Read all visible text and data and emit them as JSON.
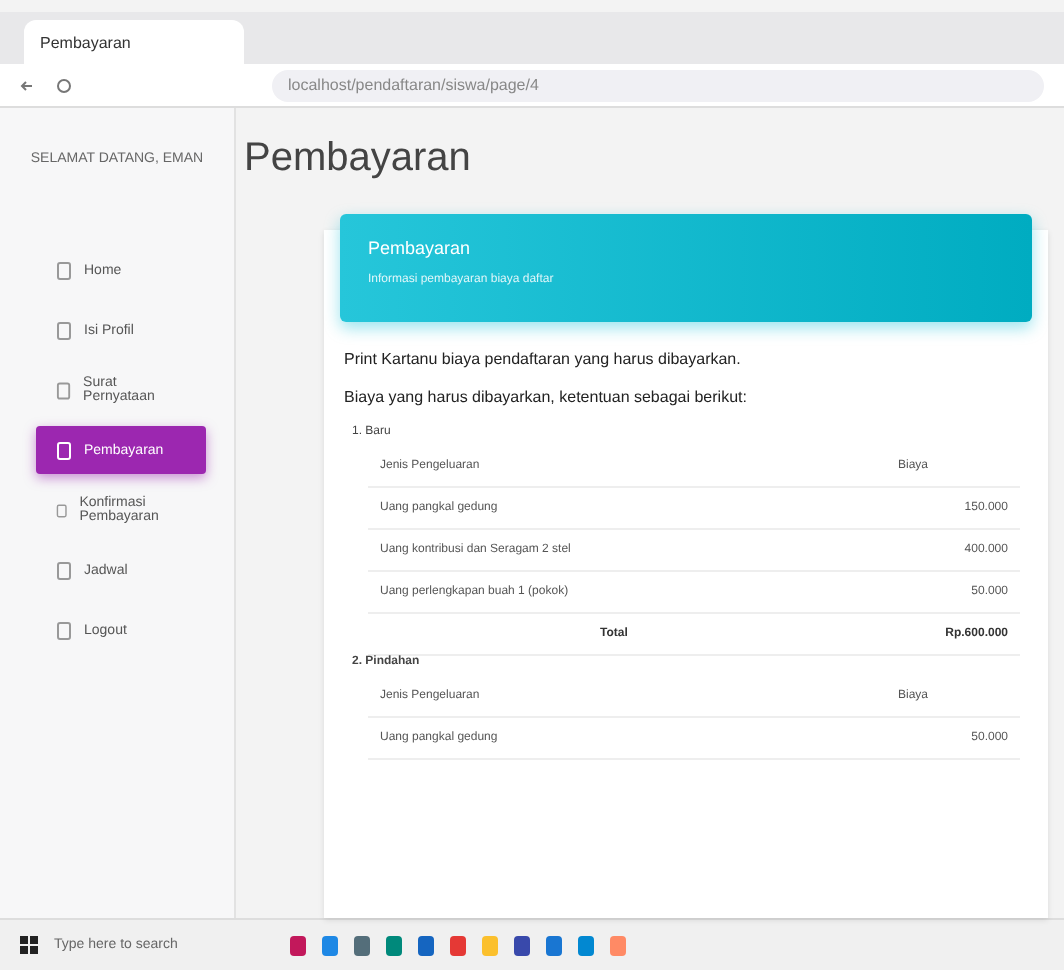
{
  "browser": {
    "tab_title": "Pembayaran",
    "address": "localhost/pendaftaran/siswa/page/4"
  },
  "sidebar": {
    "greeting": "SELAMAT DATANG, EMAN",
    "items": [
      {
        "label": "Home",
        "selected": false
      },
      {
        "label": "Isi Profil",
        "selected": false
      },
      {
        "label": "Surat Pernyataan",
        "selected": false
      },
      {
        "label": "Pembayaran",
        "selected": true
      },
      {
        "label": "Konfirmasi Pembayaran",
        "selected": false
      },
      {
        "label": "Jadwal",
        "selected": false
      },
      {
        "label": "Logout",
        "selected": false
      }
    ]
  },
  "page_title": "Pembayaran",
  "banner": {
    "title": "Pembayaran",
    "subtitle": "Informasi pembayaran biaya daftar"
  },
  "intro": [
    "Print Kartanu biaya pendaftaran yang harus dibayarkan.",
    "Biaya yang harus dibayarkan, ketentuan sebagai berikut:"
  ],
  "sections": [
    {
      "label": "1. Baru",
      "columns": [
        "Jenis Pengeluaran",
        "Biaya"
      ],
      "rows": [
        [
          "Uang pangkal gedung",
          "150.000"
        ],
        [
          "Uang kontribusi dan Seragam 2 stel",
          "400.000"
        ],
        [
          "Uang perlengkapan buah 1 (pokok)",
          "50.000"
        ]
      ],
      "total": {
        "label": "Total",
        "value": "Rp.600.000"
      }
    },
    {
      "label": "2. Pindahan",
      "columns": [
        "Jenis Pengeluaran",
        "Biaya"
      ],
      "rows": [
        [
          "Uang pangkal gedung",
          "50.000"
        ]
      ]
    }
  ],
  "taskbar": {
    "search_placeholder": "Type here to search"
  }
}
